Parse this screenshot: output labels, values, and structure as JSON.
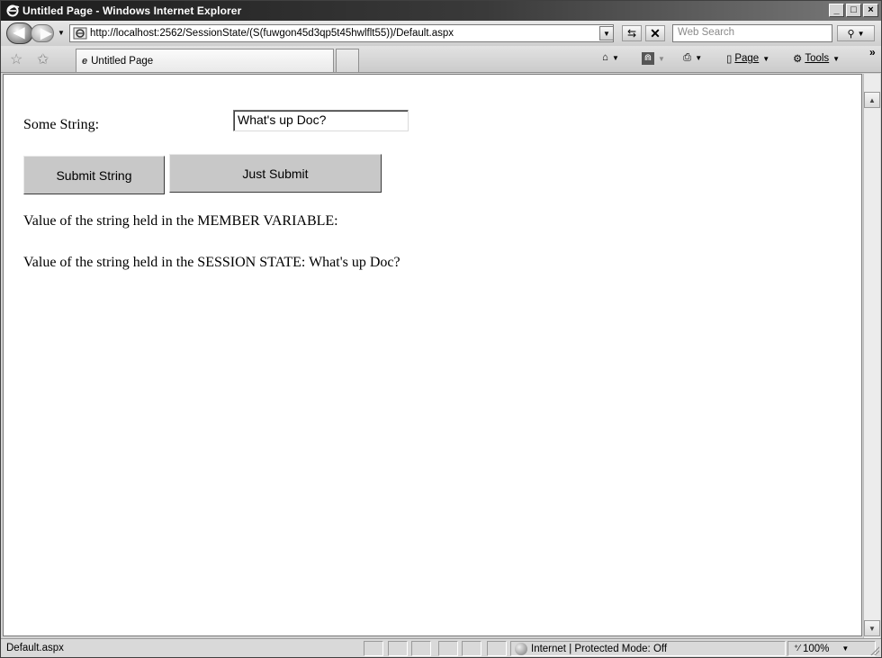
{
  "window": {
    "title": "Untitled Page - Windows Internet Explorer",
    "minimize": "_",
    "maximize": "□",
    "close": "×"
  },
  "address_bar": {
    "url": "http://localhost:2562/SessionState/(S(fuwgon45d3qp5t45hwlflt55))/Default.aspx",
    "search_placeholder": "Web Search"
  },
  "tabs": [
    {
      "label": "Untitled Page",
      "icon": "ie-page-icon"
    }
  ],
  "command_bar": {
    "page_label": "Page",
    "tools_label": "Tools",
    "more": "»"
  },
  "page": {
    "some_string_label": "Some String:",
    "input_value": "What's up Doc?",
    "submit_string_button": "Submit String",
    "just_submit_button": "Just Submit",
    "member_variable_line": "Value of the string held in the MEMBER VARIABLE:",
    "session_state_line": "Value of the string held in the SESSION STATE: What's up Doc?"
  },
  "status_bar": {
    "text": "Default.aspx",
    "zone": "Internet | Protected Mode: Off",
    "zoom": "100%"
  },
  "icons": {
    "back": "back-arrow-icon",
    "forward": "forward-arrow-icon",
    "refresh": "refresh-icon",
    "stop": "stop-icon",
    "search": "search-icon",
    "favorites": "favorites-star-icon",
    "add_favorites": "add-favorites-icon",
    "home": "home-icon",
    "feeds": "feeds-icon",
    "print": "print-icon",
    "page": "page-icon",
    "tools": "tools-gear-icon"
  }
}
